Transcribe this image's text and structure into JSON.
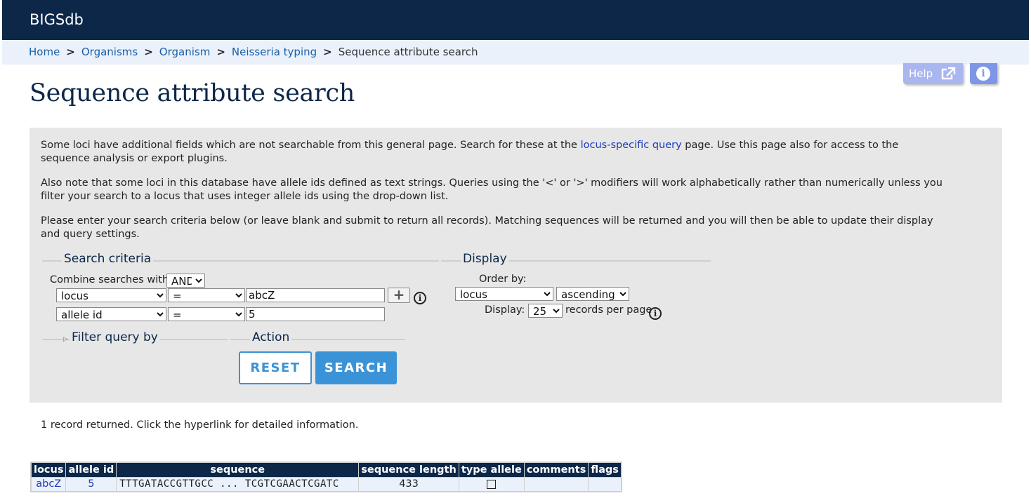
{
  "app": {
    "title": "BIGSdb"
  },
  "breadcrumb": {
    "items": [
      "Home",
      "Organisms",
      "Organism",
      "Neisseria typing"
    ],
    "separator": ">",
    "current": "Sequence attribute search"
  },
  "toolbar": {
    "help_label": "Help",
    "help_icon": "external-link-icon",
    "info_icon": "info-icon"
  },
  "page": {
    "title": "Sequence attribute search"
  },
  "intro": {
    "p1_before": "Some loci have additional fields which are not searchable from this general page. Search for these at the ",
    "p1_link": "locus-specific query",
    "p1_after": " page. Use this page also for access to the sequence analysis or export plugins.",
    "p2": "Also note that some loci in this database have allele ids defined as text strings. Queries using the '<' or '>' modifiers will work alphabetically rather than numerically unless you filter your search to a locus that uses integer allele ids using the drop-down list.",
    "p3": "Please enter your search criteria below (or leave blank and submit to return all records). Matching sequences will be returned and you will then be able to update their display and query settings."
  },
  "search": {
    "legend": "Search criteria",
    "combine_label": "Combine searches with:",
    "combine_value": "AND",
    "rows": [
      {
        "field": "locus",
        "operator": "=",
        "value": "abcZ"
      },
      {
        "field": "allele id",
        "operator": "=",
        "value": "5"
      }
    ],
    "add_label": "+"
  },
  "display": {
    "legend": "Display",
    "order_label": "Order by:",
    "order_value": "locus",
    "direction_value": "ascending",
    "display_label": "Display:",
    "per_page_value": "25",
    "per_page_suffix": "records per page"
  },
  "filter": {
    "legend": "Filter query by"
  },
  "action": {
    "legend": "Action",
    "reset_label": "RESET",
    "search_label": "SEARCH"
  },
  "results": {
    "summary": "1 record returned. Click the hyperlink for detailed information.",
    "columns": [
      "locus",
      "allele id",
      "sequence",
      "sequence length",
      "type allele",
      "comments",
      "flags"
    ],
    "rows": [
      {
        "locus": "abcZ",
        "allele_id": "5",
        "sequence": "TTTGATACCGTTGCC ... TCGTCGAACTCGATC",
        "length": "433",
        "comments": "",
        "flags": ""
      }
    ]
  },
  "colors": {
    "header": "#0c2748",
    "accent": "#3a93d7",
    "panel": "#e7e7e7",
    "link": "#1a3bbd"
  }
}
